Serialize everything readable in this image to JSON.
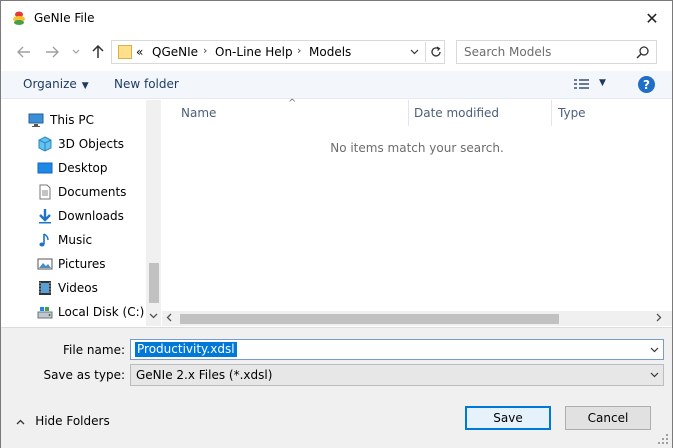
{
  "window": {
    "title": "GeNIe File",
    "close_glyph": "✕"
  },
  "address": {
    "crumbs": [
      "«",
      "QGeNIe",
      "On-Line Help",
      "Models"
    ],
    "separator": "›"
  },
  "search": {
    "placeholder": "Search Models"
  },
  "toolbar": {
    "organize_label": "Organize",
    "new_folder_label": "New folder",
    "help_glyph": "?"
  },
  "nav_pane": {
    "items": [
      {
        "label": "This PC",
        "icon": "computer-icon"
      },
      {
        "label": "3D Objects",
        "icon": "cube-icon"
      },
      {
        "label": "Desktop",
        "icon": "desktop-icon"
      },
      {
        "label": "Documents",
        "icon": "document-icon"
      },
      {
        "label": "Downloads",
        "icon": "download-icon"
      },
      {
        "label": "Music",
        "icon": "music-icon"
      },
      {
        "label": "Pictures",
        "icon": "picture-icon"
      },
      {
        "label": "Videos",
        "icon": "video-icon"
      },
      {
        "label": "Local Disk (C:)",
        "icon": "disk-icon"
      }
    ]
  },
  "file_list": {
    "columns": [
      "Name",
      "Date modified",
      "Type"
    ],
    "empty_message": "No items match your search."
  },
  "form": {
    "filename_label": "File name:",
    "filename_value": "Productivity.xdsl",
    "savetype_label": "Save as type:",
    "savetype_value": "GeNIe 2.x Files (*.xdsl)"
  },
  "footer": {
    "hide_folders_label": "Hide Folders",
    "save_label": "Save",
    "cancel_label": "Cancel"
  },
  "colors": {
    "accent": "#0078d7",
    "toolbar_bg": "#f3f6fb",
    "panel_bg": "#f0f0f0"
  }
}
